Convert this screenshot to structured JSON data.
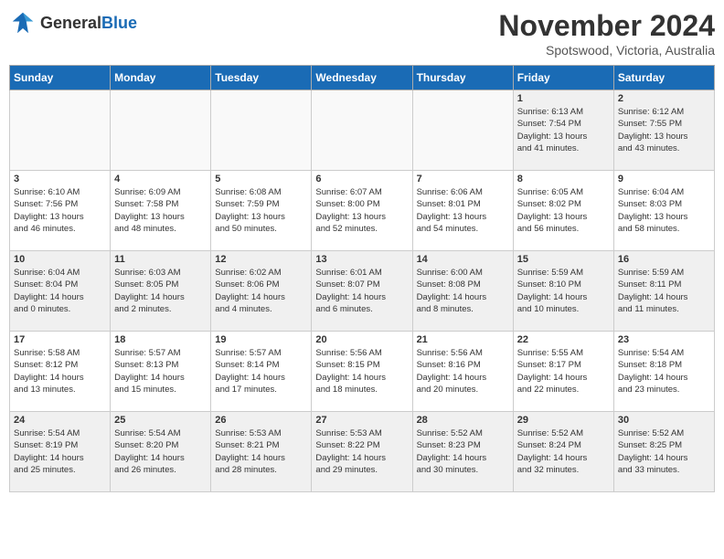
{
  "header": {
    "logo_general": "General",
    "logo_blue": "Blue",
    "month": "November 2024",
    "location": "Spotswood, Victoria, Australia"
  },
  "weekdays": [
    "Sunday",
    "Monday",
    "Tuesday",
    "Wednesday",
    "Thursday",
    "Friday",
    "Saturday"
  ],
  "weeks": [
    [
      {
        "day": "",
        "info": "",
        "empty": true
      },
      {
        "day": "",
        "info": "",
        "empty": true
      },
      {
        "day": "",
        "info": "",
        "empty": true
      },
      {
        "day": "",
        "info": "",
        "empty": true
      },
      {
        "day": "",
        "info": "",
        "empty": true
      },
      {
        "day": "1",
        "info": "Sunrise: 6:13 AM\nSunset: 7:54 PM\nDaylight: 13 hours\nand 41 minutes.",
        "empty": false
      },
      {
        "day": "2",
        "info": "Sunrise: 6:12 AM\nSunset: 7:55 PM\nDaylight: 13 hours\nand 43 minutes.",
        "empty": false
      }
    ],
    [
      {
        "day": "3",
        "info": "Sunrise: 6:10 AM\nSunset: 7:56 PM\nDaylight: 13 hours\nand 46 minutes.",
        "empty": false
      },
      {
        "day": "4",
        "info": "Sunrise: 6:09 AM\nSunset: 7:58 PM\nDaylight: 13 hours\nand 48 minutes.",
        "empty": false
      },
      {
        "day": "5",
        "info": "Sunrise: 6:08 AM\nSunset: 7:59 PM\nDaylight: 13 hours\nand 50 minutes.",
        "empty": false
      },
      {
        "day": "6",
        "info": "Sunrise: 6:07 AM\nSunset: 8:00 PM\nDaylight: 13 hours\nand 52 minutes.",
        "empty": false
      },
      {
        "day": "7",
        "info": "Sunrise: 6:06 AM\nSunset: 8:01 PM\nDaylight: 13 hours\nand 54 minutes.",
        "empty": false
      },
      {
        "day": "8",
        "info": "Sunrise: 6:05 AM\nSunset: 8:02 PM\nDaylight: 13 hours\nand 56 minutes.",
        "empty": false
      },
      {
        "day": "9",
        "info": "Sunrise: 6:04 AM\nSunset: 8:03 PM\nDaylight: 13 hours\nand 58 minutes.",
        "empty": false
      }
    ],
    [
      {
        "day": "10",
        "info": "Sunrise: 6:04 AM\nSunset: 8:04 PM\nDaylight: 14 hours\nand 0 minutes.",
        "empty": false
      },
      {
        "day": "11",
        "info": "Sunrise: 6:03 AM\nSunset: 8:05 PM\nDaylight: 14 hours\nand 2 minutes.",
        "empty": false
      },
      {
        "day": "12",
        "info": "Sunrise: 6:02 AM\nSunset: 8:06 PM\nDaylight: 14 hours\nand 4 minutes.",
        "empty": false
      },
      {
        "day": "13",
        "info": "Sunrise: 6:01 AM\nSunset: 8:07 PM\nDaylight: 14 hours\nand 6 minutes.",
        "empty": false
      },
      {
        "day": "14",
        "info": "Sunrise: 6:00 AM\nSunset: 8:08 PM\nDaylight: 14 hours\nand 8 minutes.",
        "empty": false
      },
      {
        "day": "15",
        "info": "Sunrise: 5:59 AM\nSunset: 8:10 PM\nDaylight: 14 hours\nand 10 minutes.",
        "empty": false
      },
      {
        "day": "16",
        "info": "Sunrise: 5:59 AM\nSunset: 8:11 PM\nDaylight: 14 hours\nand 11 minutes.",
        "empty": false
      }
    ],
    [
      {
        "day": "17",
        "info": "Sunrise: 5:58 AM\nSunset: 8:12 PM\nDaylight: 14 hours\nand 13 minutes.",
        "empty": false
      },
      {
        "day": "18",
        "info": "Sunrise: 5:57 AM\nSunset: 8:13 PM\nDaylight: 14 hours\nand 15 minutes.",
        "empty": false
      },
      {
        "day": "19",
        "info": "Sunrise: 5:57 AM\nSunset: 8:14 PM\nDaylight: 14 hours\nand 17 minutes.",
        "empty": false
      },
      {
        "day": "20",
        "info": "Sunrise: 5:56 AM\nSunset: 8:15 PM\nDaylight: 14 hours\nand 18 minutes.",
        "empty": false
      },
      {
        "day": "21",
        "info": "Sunrise: 5:56 AM\nSunset: 8:16 PM\nDaylight: 14 hours\nand 20 minutes.",
        "empty": false
      },
      {
        "day": "22",
        "info": "Sunrise: 5:55 AM\nSunset: 8:17 PM\nDaylight: 14 hours\nand 22 minutes.",
        "empty": false
      },
      {
        "day": "23",
        "info": "Sunrise: 5:54 AM\nSunset: 8:18 PM\nDaylight: 14 hours\nand 23 minutes.",
        "empty": false
      }
    ],
    [
      {
        "day": "24",
        "info": "Sunrise: 5:54 AM\nSunset: 8:19 PM\nDaylight: 14 hours\nand 25 minutes.",
        "empty": false
      },
      {
        "day": "25",
        "info": "Sunrise: 5:54 AM\nSunset: 8:20 PM\nDaylight: 14 hours\nand 26 minutes.",
        "empty": false
      },
      {
        "day": "26",
        "info": "Sunrise: 5:53 AM\nSunset: 8:21 PM\nDaylight: 14 hours\nand 28 minutes.",
        "empty": false
      },
      {
        "day": "27",
        "info": "Sunrise: 5:53 AM\nSunset: 8:22 PM\nDaylight: 14 hours\nand 29 minutes.",
        "empty": false
      },
      {
        "day": "28",
        "info": "Sunrise: 5:52 AM\nSunset: 8:23 PM\nDaylight: 14 hours\nand 30 minutes.",
        "empty": false
      },
      {
        "day": "29",
        "info": "Sunrise: 5:52 AM\nSunset: 8:24 PM\nDaylight: 14 hours\nand 32 minutes.",
        "empty": false
      },
      {
        "day": "30",
        "info": "Sunrise: 5:52 AM\nSunset: 8:25 PM\nDaylight: 14 hours\nand 33 minutes.",
        "empty": false
      }
    ]
  ]
}
